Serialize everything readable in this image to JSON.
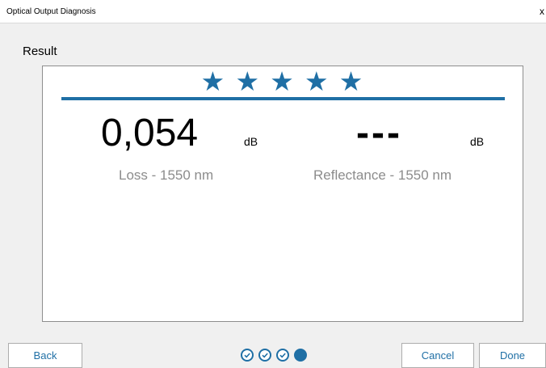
{
  "window": {
    "title": "Optical Output Diagnosis",
    "close_glyph": "x",
    "close_icon": "close-icon"
  },
  "section": {
    "label": "Result"
  },
  "result": {
    "rating": {
      "stars_filled": 5,
      "stars_total": 5,
      "glyph": "★",
      "color": "#1f6fa5"
    },
    "loss": {
      "value": "0,054",
      "unit": "dB",
      "caption": "Loss - 1550 nm"
    },
    "reflectance": {
      "value": "---",
      "unit": "dB",
      "caption": "Reflectance - 1550 nm"
    }
  },
  "footer": {
    "back_label": "Back",
    "cancel_label": "Cancel",
    "done_label": "Done",
    "steps": {
      "completed": 3,
      "total": 4,
      "current": 4
    }
  },
  "colors": {
    "accent": "#1f6fa5",
    "caption_gray": "#8c8c8c"
  }
}
